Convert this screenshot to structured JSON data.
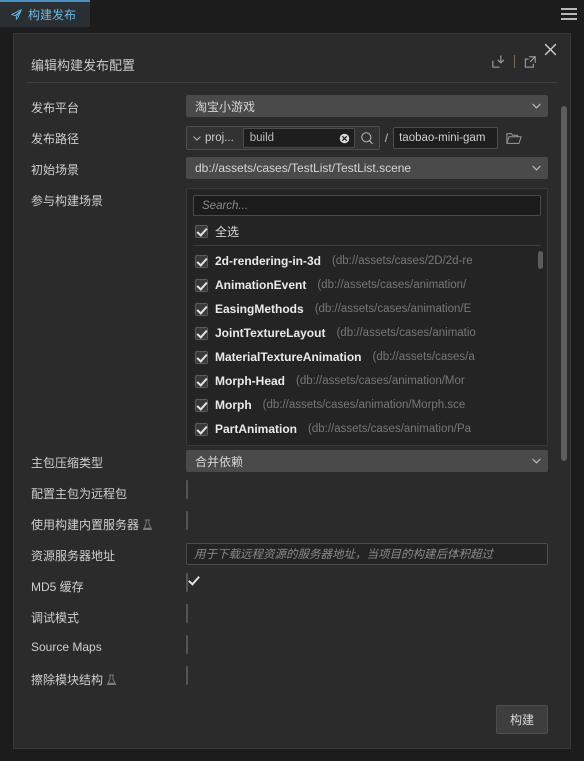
{
  "tab": {
    "label": "构建发布",
    "icon": "paper-plane-icon"
  },
  "menu": {
    "icon": "hamburger-menu-icon"
  },
  "dialog": {
    "title": "编辑构建发布配置",
    "import_icon": "import-icon",
    "export_icon": "export-icon",
    "close_icon": "close-icon"
  },
  "fields": {
    "platform": {
      "label": "发布平台",
      "value": "淘宝小游戏"
    },
    "path": {
      "label": "发布路径",
      "dropdown": "proj...",
      "input_value": "build",
      "separator": "/",
      "tail_value": "taobao-mini-gam"
    },
    "start_scene": {
      "label": "初始场景",
      "value": "db://assets/cases/TestList/TestList.scene"
    },
    "scenes": {
      "label": "参与构建场景"
    },
    "compress": {
      "label": "主包压缩类型",
      "value": "合并依赖"
    },
    "remote_main": {
      "label": "配置主包为远程包",
      "checked": false
    },
    "builtin_server": {
      "label": "使用构建内置服务器",
      "checked": false,
      "beta": true
    },
    "server_url": {
      "label": "资源服务器地址",
      "placeholder": "用于下载远程资源的服务器地址，当项目的构建后体积超过"
    },
    "md5": {
      "label": "MD5 缓存",
      "checked": true
    },
    "debug": {
      "label": "调试模式",
      "checked": false
    },
    "source_maps": {
      "label": "Source Maps",
      "checked": false
    },
    "erase_module": {
      "label": "擦除模块结构",
      "checked": false,
      "beta": true
    }
  },
  "scene_list": {
    "search_placeholder": "Search...",
    "select_all": {
      "label": "全选",
      "checked": true
    },
    "items": [
      {
        "name": "2d-rendering-in-3d",
        "path": "(db://assets/cases/2D/2d-re",
        "checked": true
      },
      {
        "name": "AnimationEvent",
        "path": "(db://assets/cases/animation/",
        "checked": true
      },
      {
        "name": "EasingMethods",
        "path": "(db://assets/cases/animation/E",
        "checked": true
      },
      {
        "name": "JointTextureLayout",
        "path": "(db://assets/cases/animatio",
        "checked": true
      },
      {
        "name": "MaterialTextureAnimation",
        "path": "(db://assets/cases/a",
        "checked": true
      },
      {
        "name": "Morph-Head",
        "path": "(db://assets/cases/animation/Mor",
        "checked": true
      },
      {
        "name": "Morph",
        "path": "(db://assets/cases/animation/Morph.sce",
        "checked": true
      },
      {
        "name": "PartAnimation",
        "path": "(db://assets/cases/animation/Pa",
        "checked": true
      }
    ]
  },
  "footer": {
    "build_label": "构建"
  },
  "colors": {
    "accent": "#6cb8e0",
    "tab_border": "#4a90c2",
    "panel_bg": "#2b2b2b"
  }
}
